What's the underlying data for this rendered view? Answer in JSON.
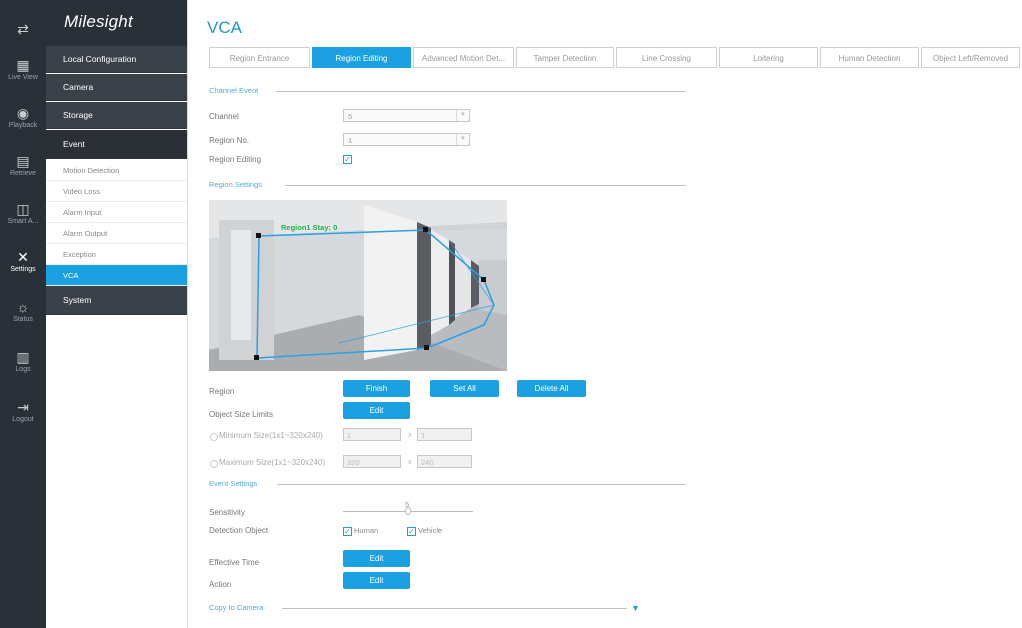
{
  "app": {
    "brand": "Milesight"
  },
  "iconbar": [
    {
      "name": "toggle-menu-icon",
      "icon": "⇄",
      "label": ""
    },
    {
      "name": "live-view-icon",
      "icon": "▦",
      "label": "Live View"
    },
    {
      "name": "playback-icon",
      "icon": "◉",
      "label": "Playback"
    },
    {
      "name": "retrieve-icon",
      "icon": "▤",
      "label": "Retrieve"
    },
    {
      "name": "smart-analytics-icon",
      "icon": "◫",
      "label": "Smart A..."
    },
    {
      "name": "settings-icon",
      "icon": "✕",
      "label": "Settings"
    },
    {
      "name": "status-icon",
      "icon": "☼",
      "label": "Status"
    },
    {
      "name": "logs-icon",
      "icon": "▥",
      "label": "Logs"
    },
    {
      "name": "logout-icon",
      "icon": "⇥",
      "label": "Logout"
    }
  ],
  "menu": {
    "local_configuration": "Local Configuration",
    "camera": "Camera",
    "storage": "Storage",
    "event": "Event",
    "event_items": [
      "Motion Detection",
      "Video Loss",
      "Alarm Input",
      "Alarm Output",
      "Exception",
      "VCA"
    ],
    "system": "System"
  },
  "page": {
    "title": "VCA"
  },
  "tabs": [
    "Region Entrance",
    "Region Editing",
    "Advanced Motion Det...",
    "Tamper Detection",
    "Line Crossing",
    "Loitering",
    "Human Detection",
    "Object Left/Removed"
  ],
  "channel_event": {
    "title": "Channel Event",
    "channel_label": "Channel",
    "channel_value": "5",
    "region_no_label": "Region No.",
    "region_no_value": "1",
    "region_editing_label": "Region Editing",
    "region_editing_checked": true
  },
  "region_settings": {
    "title": "Region Settings",
    "overlay_label": "Region1 Stay: 0",
    "region_label": "Region",
    "finish_button": "Finish",
    "set_all_button": "Set All",
    "delete_all_button": "Delete All",
    "object_size_label": "Object Size Limits",
    "edit_button": "Edit",
    "min_size_label": "Minimum Size(1x1~320x240)",
    "min_w": "1",
    "min_h": "1",
    "max_size_label": "Maximum Size(1x1~320x240)",
    "max_w": "320",
    "max_h": "240",
    "times": "x"
  },
  "event_settings": {
    "title": "Event Settings",
    "sensitivity_label": "Sensitivity",
    "sensitivity_value": "5",
    "sensitivity_level": 0.5,
    "detection_object_label": "Detection Object",
    "human_label": "Human",
    "vehicle_label": "Vehicle",
    "effective_time_label": "Effective Time",
    "effective_edit": "Edit",
    "action_label": "Action",
    "action_edit": "Edit"
  },
  "copy_to_camera": {
    "title": "Copy to Camera"
  },
  "colors": {
    "accent": "#1ba1e2",
    "sidebar": "#2a3038",
    "menu": "#3b4148"
  }
}
